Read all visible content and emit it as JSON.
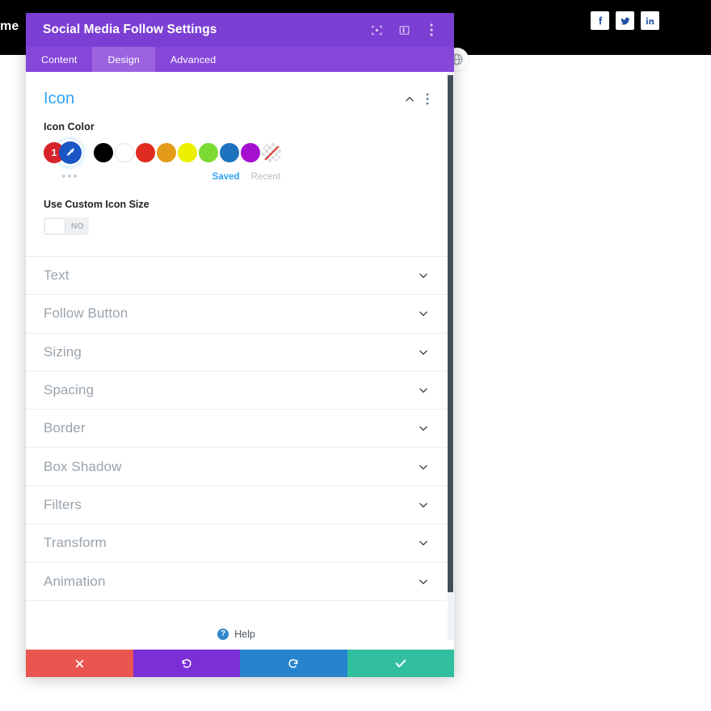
{
  "page": {
    "brand_text": "me",
    "social_links": [
      {
        "name": "facebook",
        "glyph": "f"
      },
      {
        "name": "twitter",
        "glyph": "twitter"
      },
      {
        "name": "linkedin",
        "glyph": "in"
      }
    ],
    "floating_badge": "globe-icon"
  },
  "modal": {
    "title": "Social Media Follow Settings",
    "header_icons": [
      {
        "name": "focus-target-icon"
      },
      {
        "name": "layout-columns-icon"
      },
      {
        "name": "more-vertical-icon"
      }
    ],
    "tabs": [
      {
        "label": "Content",
        "active": false
      },
      {
        "label": "Design",
        "active": true
      },
      {
        "label": "Advanced",
        "active": false
      }
    ]
  },
  "icon_section": {
    "title": "Icon",
    "collapse_icon": "chevron-up-icon",
    "options_icon": "more-vertical-icon",
    "color_field_label": "Icon Color",
    "selected_count": "1",
    "picker_icon": "eyedropper-icon",
    "more_colors": "•••",
    "swatches": [
      {
        "name": "black",
        "hex": "#000000"
      },
      {
        "name": "white",
        "hex": "#ffffff"
      },
      {
        "name": "red",
        "hex": "#e02b20"
      },
      {
        "name": "orange",
        "hex": "#e59b1a"
      },
      {
        "name": "yellow",
        "hex": "#edf000"
      },
      {
        "name": "green",
        "hex": "#7cdb33"
      },
      {
        "name": "blue",
        "hex": "#1e73be"
      },
      {
        "name": "purple",
        "hex": "#a40fd0"
      },
      {
        "name": "transparent",
        "hex": "transparent"
      }
    ],
    "palette_tabs": [
      {
        "label": "Saved",
        "active": true
      },
      {
        "label": "Recent",
        "active": false
      }
    ],
    "custom_size_label": "Use Custom Icon Size",
    "custom_size_value": "NO"
  },
  "accordions": [
    {
      "label": "Text"
    },
    {
      "label": "Follow Button"
    },
    {
      "label": "Sizing"
    },
    {
      "label": "Spacing"
    },
    {
      "label": "Border"
    },
    {
      "label": "Box Shadow"
    },
    {
      "label": "Filters"
    },
    {
      "label": "Transform"
    },
    {
      "label": "Animation"
    }
  ],
  "help": {
    "badge": "?",
    "label": "Help"
  },
  "action_bar": [
    {
      "name": "cancel",
      "icon": "close-icon",
      "color": "#e9564f"
    },
    {
      "name": "undo",
      "icon": "undo-icon",
      "color": "#7b2fd6"
    },
    {
      "name": "redo",
      "icon": "redo-icon",
      "color": "#2684ce"
    },
    {
      "name": "save",
      "icon": "check-icon",
      "color": "#31bfa0"
    }
  ]
}
